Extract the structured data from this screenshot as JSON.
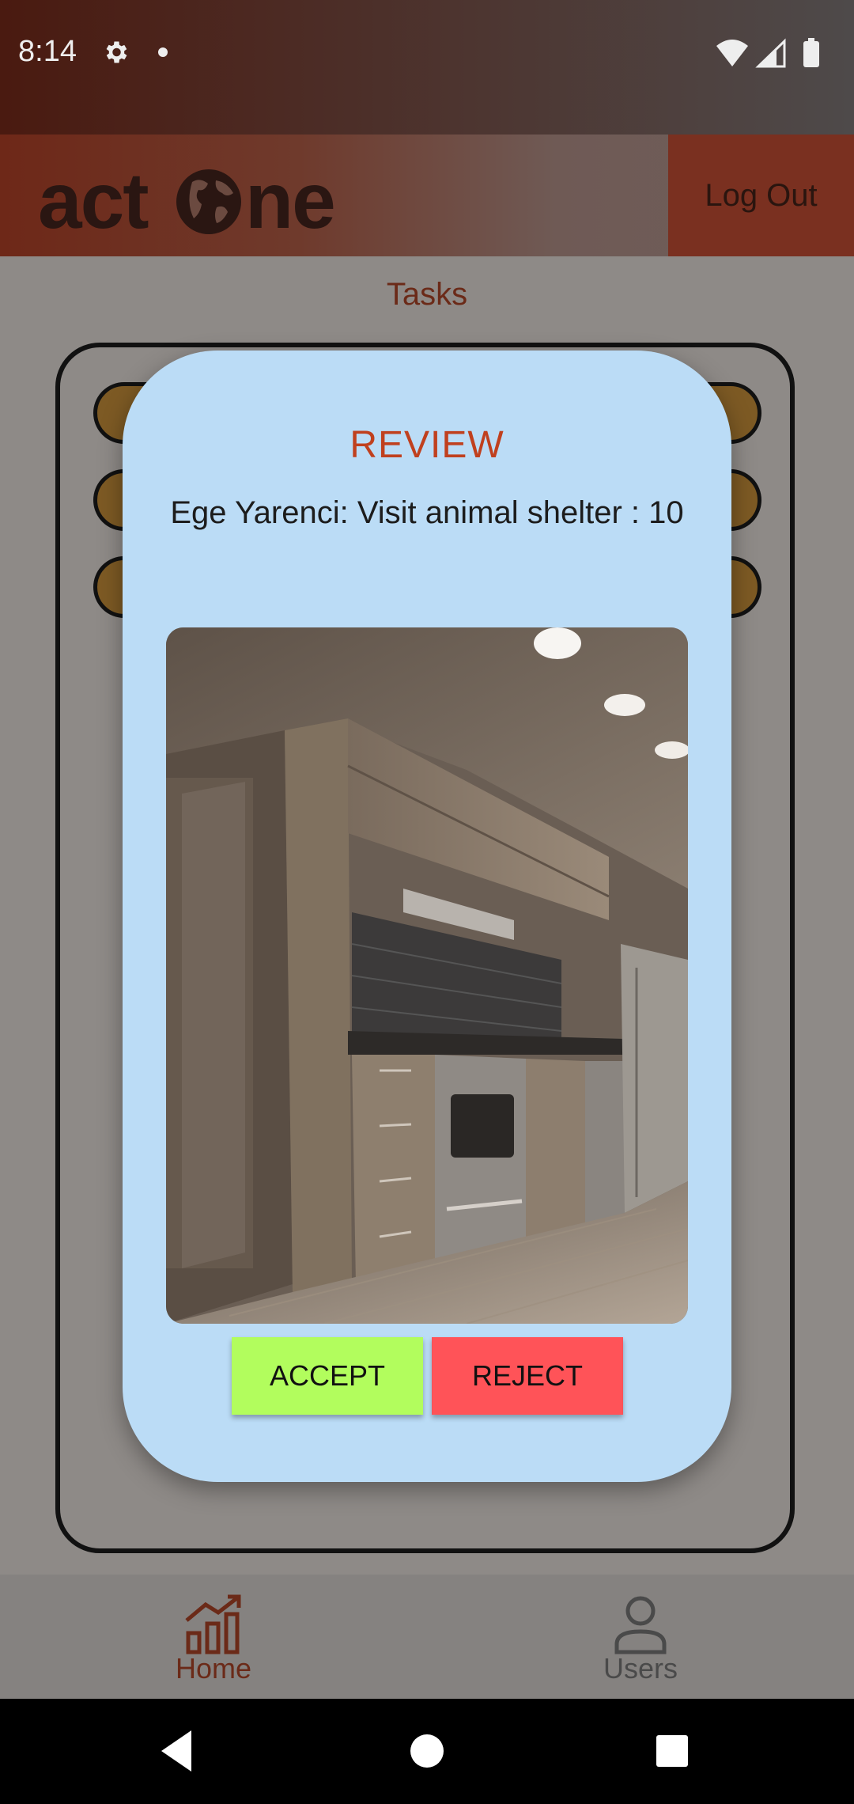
{
  "status_bar": {
    "time": "8:14"
  },
  "header": {
    "logo_text": "actone",
    "logout_label": "Log Out"
  },
  "page": {
    "title": "Tasks"
  },
  "dialog": {
    "title": "REVIEW",
    "message": "Ege Yarenci: Visit animal shelter : 10",
    "accept_label": "ACCEPT",
    "reject_label": "REJECT",
    "accept_color": "#b2fd5d",
    "reject_color": "#ff5358"
  },
  "bottom_nav": {
    "items": [
      {
        "label": "Home",
        "icon": "chart-growth-icon",
        "active": true
      },
      {
        "label": "Users",
        "icon": "person-icon",
        "active": false
      }
    ]
  },
  "colors": {
    "accent": "#c0401e",
    "dialog_bg": "#bbdcf6"
  }
}
